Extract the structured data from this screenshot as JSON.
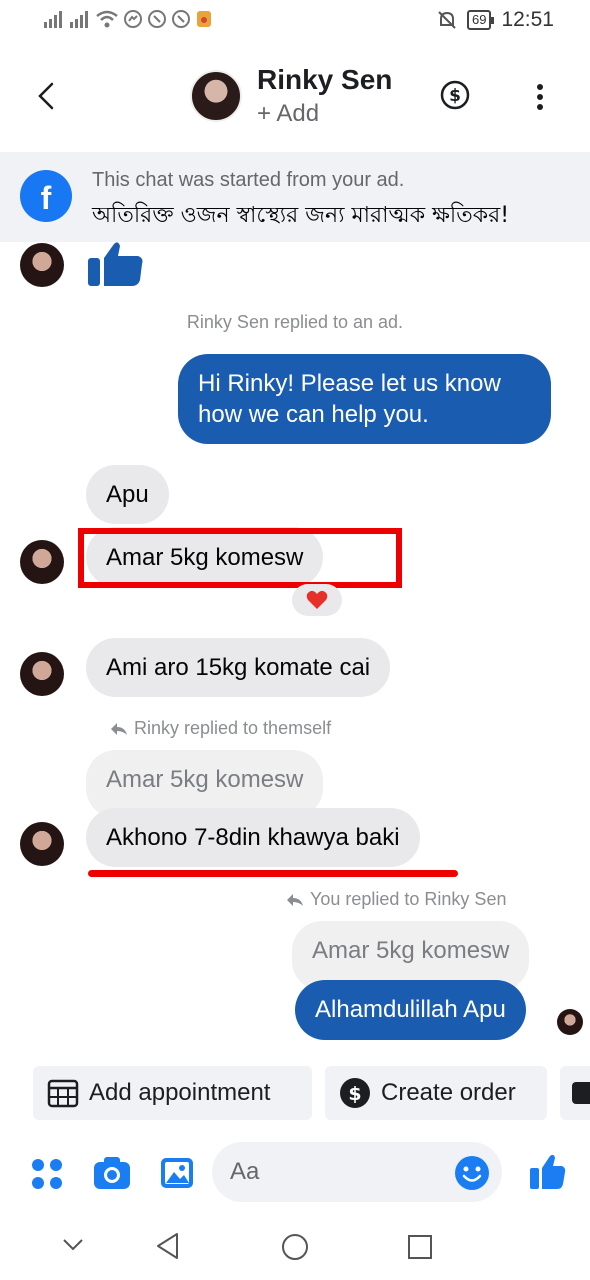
{
  "status_bar": {
    "time": "12:51",
    "battery": "69"
  },
  "header": {
    "contact_name": "Rinky Sen",
    "add_label": "+ Add"
  },
  "ad_banner": {
    "line1": "This chat was started from your ad.",
    "line2": "অতিরিক্ত ওজন স্বাস্থ্যের জন্য মারাত্মক ক্ষতিকর!"
  },
  "messages": {
    "replied_to_ad": "Rinky Sen replied to an ad.",
    "outgoing_greeting_line1": "Hi Rinky! Please let us know",
    "outgoing_greeting_line2": "how we can help you.",
    "in_apu": "Apu",
    "in_amar": "Amar 5kg komesw",
    "reaction": "❤",
    "in_ami": "Ami aro 15kg komate cai",
    "reply_note_1": "Rinky replied to themself",
    "quoted_1": "Amar 5kg komesw",
    "in_akhono": "Akhono 7-8din khawya baki",
    "reply_note_2": "You replied to Rinky Sen",
    "quoted_2": "Amar 5kg komesw",
    "out_alhamdulillah": "Alhamdulillah Apu"
  },
  "quick_actions": {
    "add_appointment": "Add appointment",
    "create_order": "Create order"
  },
  "composer": {
    "placeholder": "Aa"
  },
  "colors": {
    "accent": "#1a5cb0",
    "fb_blue": "#1877f2",
    "annotation_red": "#ee0000"
  }
}
